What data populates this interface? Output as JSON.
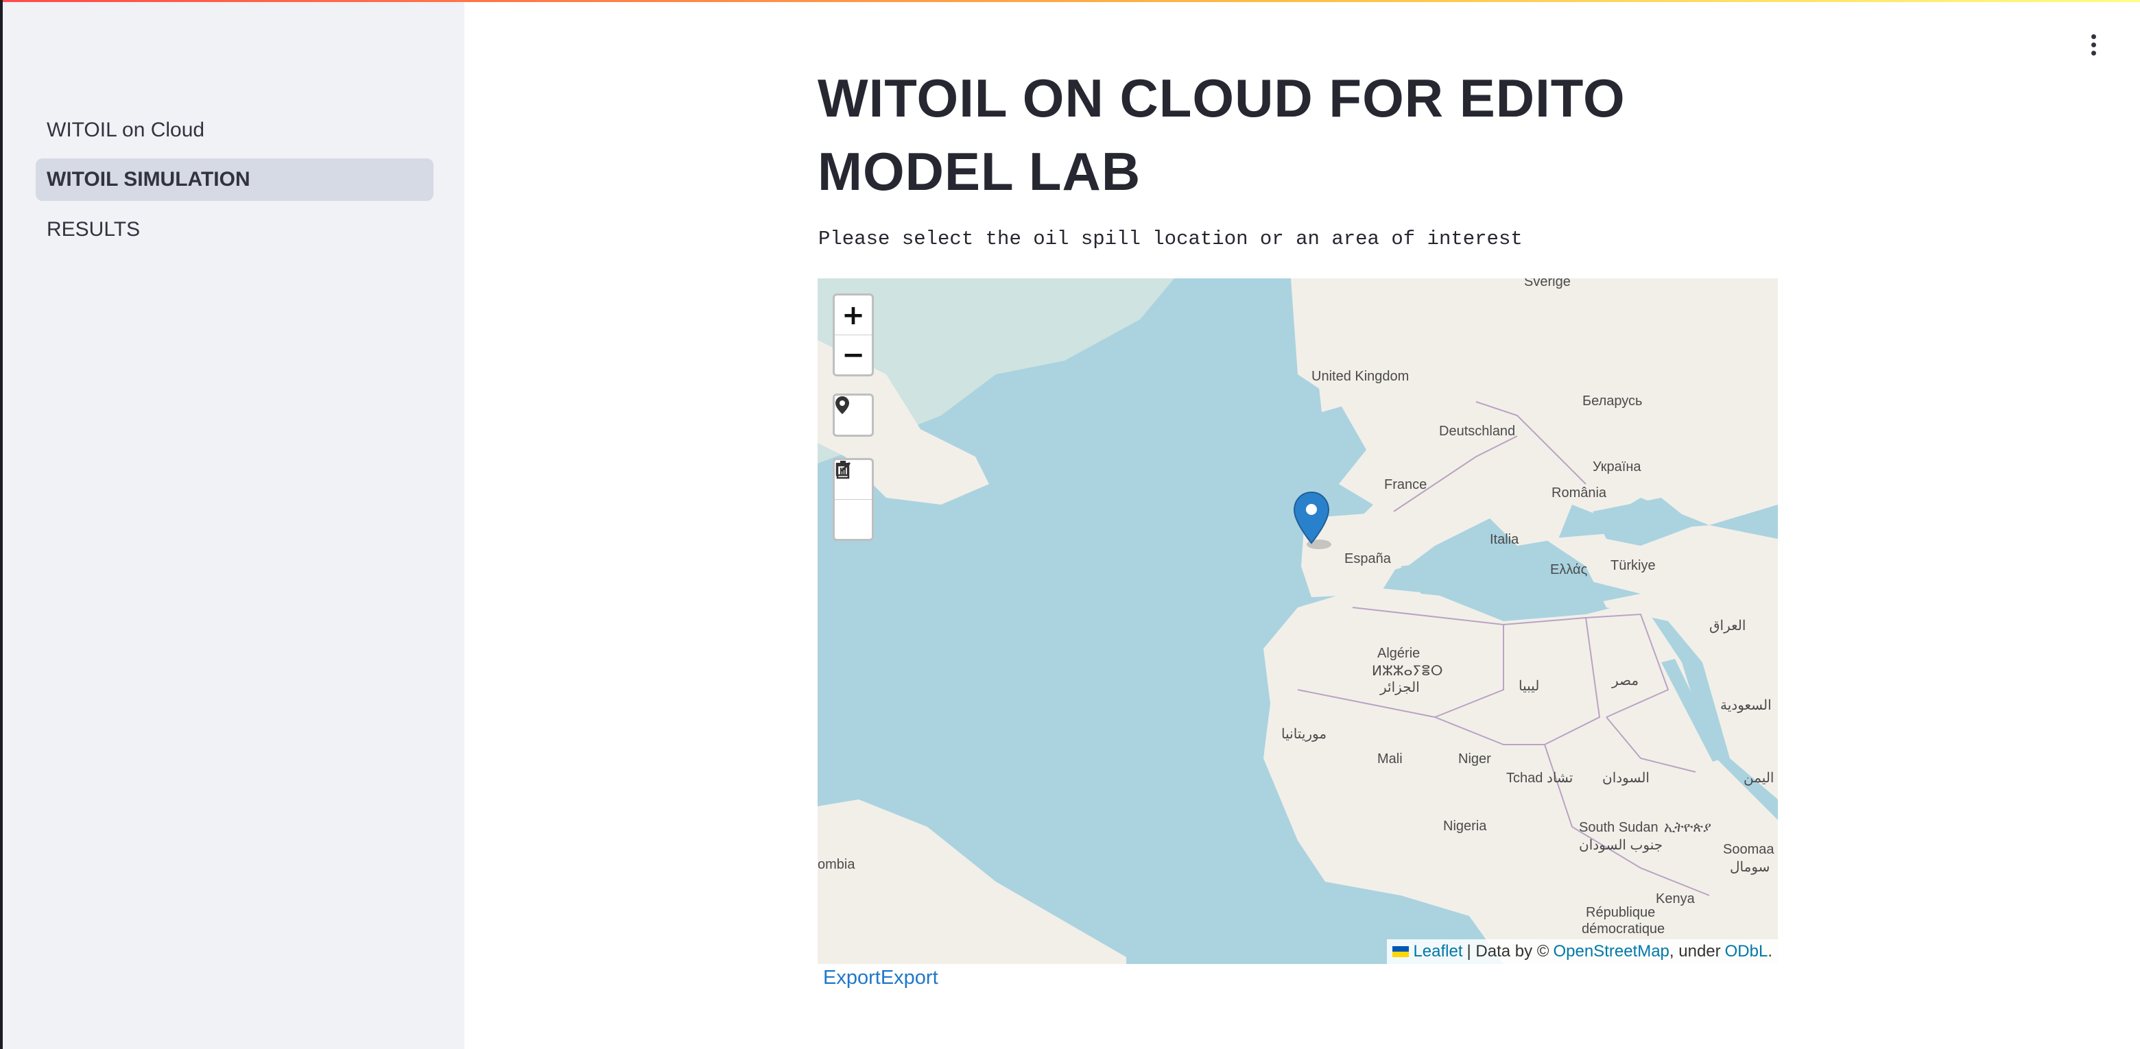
{
  "sidebar": {
    "items": [
      {
        "label": "WITOIL on Cloud",
        "active": false
      },
      {
        "label": "WITOIL SIMULATION",
        "active": true
      },
      {
        "label": "RESULTS",
        "active": false
      }
    ]
  },
  "main": {
    "title_line1": "WITOIL ON CLOUD FOR EDITO",
    "title_line2": "MODEL LAB",
    "instruction": "Please select the oil spill location or an area of interest",
    "export_label": "ExportExport"
  },
  "map": {
    "controls": {
      "zoom_in": "+",
      "zoom_out": "−",
      "marker_icon": "map-marker-icon",
      "edit_icon": "edit-icon",
      "delete_icon": "trash-icon"
    },
    "labels": [
      "United Kingdom",
      "Deutschland",
      "Беларусь",
      "France",
      "Україна",
      "România",
      "España",
      "Italia",
      "Ελλάς",
      "Türkiye",
      "Algérie",
      "ⵍⵣⵣⴰⵢⴻⵔ",
      "الجزائر",
      "ليبيا",
      "مصر",
      "العراق",
      "موريتانيا",
      "السعودية",
      "Mali",
      "Niger",
      "Tchad تشاد",
      "السودان",
      "Nigeria",
      "South Sudan",
      "جنوب السودان",
      "ኢትዮጵያ",
      "République",
      "démocratique",
      "Kenya",
      "Soomaa",
      "سومال",
      "اليمن",
      "ombia",
      "Sverige"
    ],
    "attribution": {
      "leaflet": "Leaflet",
      "separator": " | Data by © ",
      "osm": "OpenStreetMap",
      "under": ", under ",
      "odbl": "ODbL",
      "end": "."
    },
    "colors": {
      "water": "#aad3df",
      "land": "#f2efe9",
      "border": "#b9a3c3",
      "marker": "#2a81cb"
    }
  }
}
